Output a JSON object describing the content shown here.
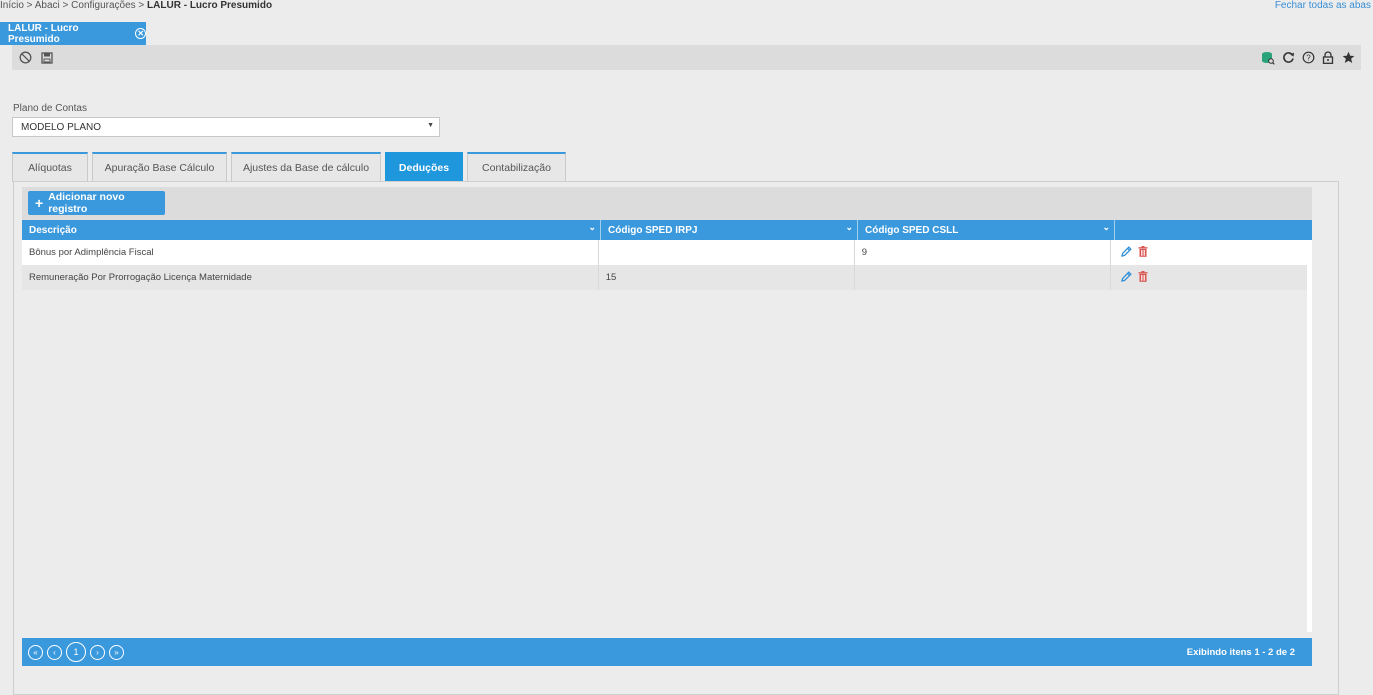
{
  "breadcrumb": {
    "path": "Início > Abaci > Configurações > ",
    "current": "LALUR - Lucro Presumido"
  },
  "close_all_tabs": "Fechar todas as abas",
  "page_tab": {
    "label": "LALUR - Lucro Presumido"
  },
  "toolbar": {
    "left_icons": [
      "cancel-icon",
      "save-icon"
    ],
    "right_icons": [
      "database-search-icon",
      "refresh-icon",
      "help-icon",
      "lock-icon",
      "star-icon"
    ]
  },
  "plano_de_contas": {
    "label": "Plano de Contas",
    "value": "MODELO PLANO"
  },
  "tabs": [
    {
      "label": "Alíquotas",
      "active": false
    },
    {
      "label": "Apuração Base Cálculo",
      "active": false
    },
    {
      "label": "Ajustes da Base de cálculo",
      "active": false
    },
    {
      "label": "Deduções",
      "active": true
    },
    {
      "label": "Contabilização",
      "active": false
    }
  ],
  "grid": {
    "add_button": "Adicionar novo registro",
    "columns": [
      "Descrição",
      "Código SPED IRPJ",
      "Código SPED CSLL",
      ""
    ],
    "rows": [
      {
        "descricao": "Bônus por Adimplência Fiscal",
        "irpj": "",
        "csll": "9"
      },
      {
        "descricao": "Remuneração Por Prorrogação Licença Maternidade",
        "irpj": "15",
        "csll": ""
      }
    ]
  },
  "pager": {
    "current_page": "1",
    "info": "Exibindo itens 1 - 2 de 2"
  },
  "colors": {
    "accent": "#3a98dc",
    "active_tab": "#1f97dd",
    "delete": "#d9534f",
    "db_icon": "#2aa37a"
  }
}
